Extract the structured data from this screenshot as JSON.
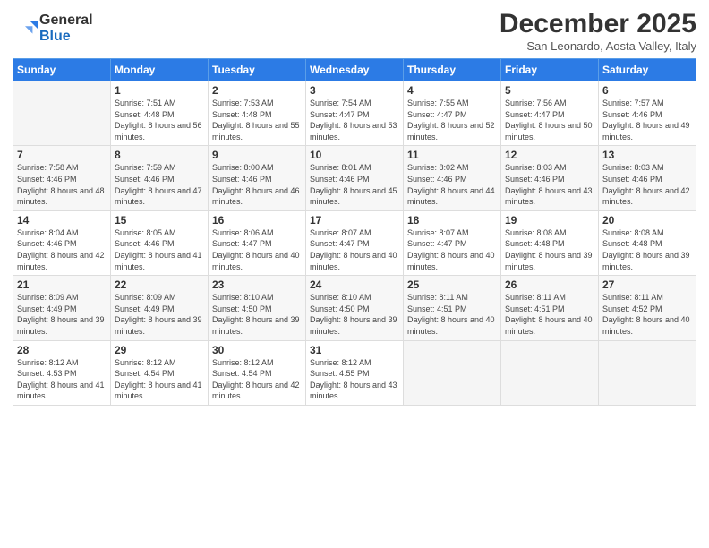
{
  "logo": {
    "general": "General",
    "blue": "Blue"
  },
  "header": {
    "title": "December 2025",
    "subtitle": "San Leonardo, Aosta Valley, Italy"
  },
  "days_of_week": [
    "Sunday",
    "Monday",
    "Tuesday",
    "Wednesday",
    "Thursday",
    "Friday",
    "Saturday"
  ],
  "weeks": [
    [
      {
        "day": "",
        "sunrise": "",
        "sunset": "",
        "daylight": ""
      },
      {
        "day": "1",
        "sunrise": "Sunrise: 7:51 AM",
        "sunset": "Sunset: 4:48 PM",
        "daylight": "Daylight: 8 hours and 56 minutes."
      },
      {
        "day": "2",
        "sunrise": "Sunrise: 7:53 AM",
        "sunset": "Sunset: 4:48 PM",
        "daylight": "Daylight: 8 hours and 55 minutes."
      },
      {
        "day": "3",
        "sunrise": "Sunrise: 7:54 AM",
        "sunset": "Sunset: 4:47 PM",
        "daylight": "Daylight: 8 hours and 53 minutes."
      },
      {
        "day": "4",
        "sunrise": "Sunrise: 7:55 AM",
        "sunset": "Sunset: 4:47 PM",
        "daylight": "Daylight: 8 hours and 52 minutes."
      },
      {
        "day": "5",
        "sunrise": "Sunrise: 7:56 AM",
        "sunset": "Sunset: 4:47 PM",
        "daylight": "Daylight: 8 hours and 50 minutes."
      },
      {
        "day": "6",
        "sunrise": "Sunrise: 7:57 AM",
        "sunset": "Sunset: 4:46 PM",
        "daylight": "Daylight: 8 hours and 49 minutes."
      }
    ],
    [
      {
        "day": "7",
        "sunrise": "Sunrise: 7:58 AM",
        "sunset": "Sunset: 4:46 PM",
        "daylight": "Daylight: 8 hours and 48 minutes."
      },
      {
        "day": "8",
        "sunrise": "Sunrise: 7:59 AM",
        "sunset": "Sunset: 4:46 PM",
        "daylight": "Daylight: 8 hours and 47 minutes."
      },
      {
        "day": "9",
        "sunrise": "Sunrise: 8:00 AM",
        "sunset": "Sunset: 4:46 PM",
        "daylight": "Daylight: 8 hours and 46 minutes."
      },
      {
        "day": "10",
        "sunrise": "Sunrise: 8:01 AM",
        "sunset": "Sunset: 4:46 PM",
        "daylight": "Daylight: 8 hours and 45 minutes."
      },
      {
        "day": "11",
        "sunrise": "Sunrise: 8:02 AM",
        "sunset": "Sunset: 4:46 PM",
        "daylight": "Daylight: 8 hours and 44 minutes."
      },
      {
        "day": "12",
        "sunrise": "Sunrise: 8:03 AM",
        "sunset": "Sunset: 4:46 PM",
        "daylight": "Daylight: 8 hours and 43 minutes."
      },
      {
        "day": "13",
        "sunrise": "Sunrise: 8:03 AM",
        "sunset": "Sunset: 4:46 PM",
        "daylight": "Daylight: 8 hours and 42 minutes."
      }
    ],
    [
      {
        "day": "14",
        "sunrise": "Sunrise: 8:04 AM",
        "sunset": "Sunset: 4:46 PM",
        "daylight": "Daylight: 8 hours and 42 minutes."
      },
      {
        "day": "15",
        "sunrise": "Sunrise: 8:05 AM",
        "sunset": "Sunset: 4:46 PM",
        "daylight": "Daylight: 8 hours and 41 minutes."
      },
      {
        "day": "16",
        "sunrise": "Sunrise: 8:06 AM",
        "sunset": "Sunset: 4:47 PM",
        "daylight": "Daylight: 8 hours and 40 minutes."
      },
      {
        "day": "17",
        "sunrise": "Sunrise: 8:07 AM",
        "sunset": "Sunset: 4:47 PM",
        "daylight": "Daylight: 8 hours and 40 minutes."
      },
      {
        "day": "18",
        "sunrise": "Sunrise: 8:07 AM",
        "sunset": "Sunset: 4:47 PM",
        "daylight": "Daylight: 8 hours and 40 minutes."
      },
      {
        "day": "19",
        "sunrise": "Sunrise: 8:08 AM",
        "sunset": "Sunset: 4:48 PM",
        "daylight": "Daylight: 8 hours and 39 minutes."
      },
      {
        "day": "20",
        "sunrise": "Sunrise: 8:08 AM",
        "sunset": "Sunset: 4:48 PM",
        "daylight": "Daylight: 8 hours and 39 minutes."
      }
    ],
    [
      {
        "day": "21",
        "sunrise": "Sunrise: 8:09 AM",
        "sunset": "Sunset: 4:49 PM",
        "daylight": "Daylight: 8 hours and 39 minutes."
      },
      {
        "day": "22",
        "sunrise": "Sunrise: 8:09 AM",
        "sunset": "Sunset: 4:49 PM",
        "daylight": "Daylight: 8 hours and 39 minutes."
      },
      {
        "day": "23",
        "sunrise": "Sunrise: 8:10 AM",
        "sunset": "Sunset: 4:50 PM",
        "daylight": "Daylight: 8 hours and 39 minutes."
      },
      {
        "day": "24",
        "sunrise": "Sunrise: 8:10 AM",
        "sunset": "Sunset: 4:50 PM",
        "daylight": "Daylight: 8 hours and 39 minutes."
      },
      {
        "day": "25",
        "sunrise": "Sunrise: 8:11 AM",
        "sunset": "Sunset: 4:51 PM",
        "daylight": "Daylight: 8 hours and 40 minutes."
      },
      {
        "day": "26",
        "sunrise": "Sunrise: 8:11 AM",
        "sunset": "Sunset: 4:51 PM",
        "daylight": "Daylight: 8 hours and 40 minutes."
      },
      {
        "day": "27",
        "sunrise": "Sunrise: 8:11 AM",
        "sunset": "Sunset: 4:52 PM",
        "daylight": "Daylight: 8 hours and 40 minutes."
      }
    ],
    [
      {
        "day": "28",
        "sunrise": "Sunrise: 8:12 AM",
        "sunset": "Sunset: 4:53 PM",
        "daylight": "Daylight: 8 hours and 41 minutes."
      },
      {
        "day": "29",
        "sunrise": "Sunrise: 8:12 AM",
        "sunset": "Sunset: 4:54 PM",
        "daylight": "Daylight: 8 hours and 41 minutes."
      },
      {
        "day": "30",
        "sunrise": "Sunrise: 8:12 AM",
        "sunset": "Sunset: 4:54 PM",
        "daylight": "Daylight: 8 hours and 42 minutes."
      },
      {
        "day": "31",
        "sunrise": "Sunrise: 8:12 AM",
        "sunset": "Sunset: 4:55 PM",
        "daylight": "Daylight: 8 hours and 43 minutes."
      },
      {
        "day": "",
        "sunrise": "",
        "sunset": "",
        "daylight": ""
      },
      {
        "day": "",
        "sunrise": "",
        "sunset": "",
        "daylight": ""
      },
      {
        "day": "",
        "sunrise": "",
        "sunset": "",
        "daylight": ""
      }
    ]
  ]
}
